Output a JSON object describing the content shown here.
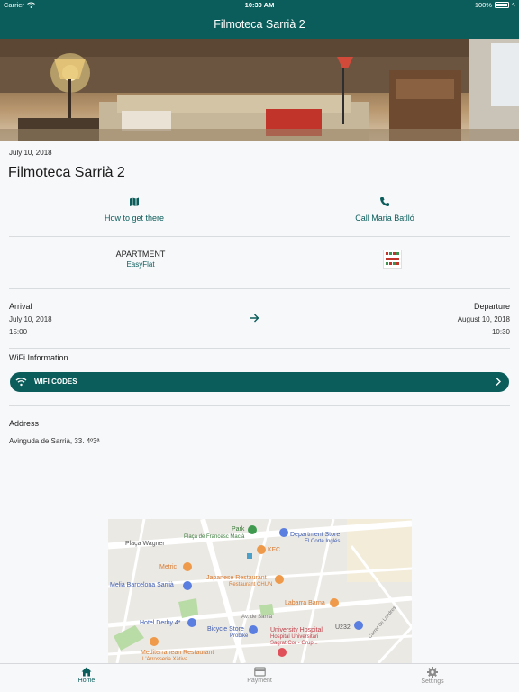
{
  "status_bar": {
    "carrier": "Carrier",
    "time": "10:30 AM",
    "battery": "100%",
    "battery_level": 1.0
  },
  "nav": {
    "title": "Filmoteca Sarrià 2"
  },
  "booking": {
    "date": "July 10, 2018",
    "title": "Filmoteca Sarrià 2",
    "directions_label": "How to get there",
    "call_label": "Call Maria Batlló",
    "apartment_type": "APARTMENT",
    "company": "EasyFlat",
    "arrival_label": "Arrival",
    "arrival_date": "July 10, 2018",
    "arrival_time": "15:00",
    "departure_label": "Departure",
    "departure_date": "August 10, 2018",
    "departure_time": "10:30",
    "wifi_title": "WiFi Information",
    "wifi_button": "WIFI CODES",
    "address_label": "Address",
    "address": "Avinguda de Sarrià, 33. 4º3ª"
  },
  "map": {
    "labels": {
      "park": "Park",
      "placa_macia": "Plaça de Francesc Macià",
      "dept_store": "Department Store",
      "corte_ingles": "El Corte Inglés",
      "placa_wagner": "Plaça Wagner",
      "kfc": "KFC",
      "metric": "Metric",
      "japanese": "Japanese Restaurant",
      "chun": "Restaurant CHUN",
      "melia": "Melià Barcelona Sarrià",
      "labarra": "Labarra Barna",
      "hotel_derby": "Hotel Derby 4*",
      "av_sarria": "Av. de Sarrià",
      "bicycle": "Bicycle Store",
      "probike": "Probike",
      "university": "University Hospital",
      "hospital": "Hospital Universitari",
      "sagrat": "Sagrat Cor - Grup...",
      "u232": "U232",
      "mediterranean": "Mediterranean Restaurant",
      "arrosseria": "L'Arrosseria Xàtiva",
      "carrer_londres": "Carrer de Londres"
    }
  },
  "tabs": {
    "home": "Home",
    "payment": "Payment",
    "settings": "Settings"
  },
  "colors": {
    "primary": "#0b5d5b",
    "background": "#f7f8fa"
  }
}
